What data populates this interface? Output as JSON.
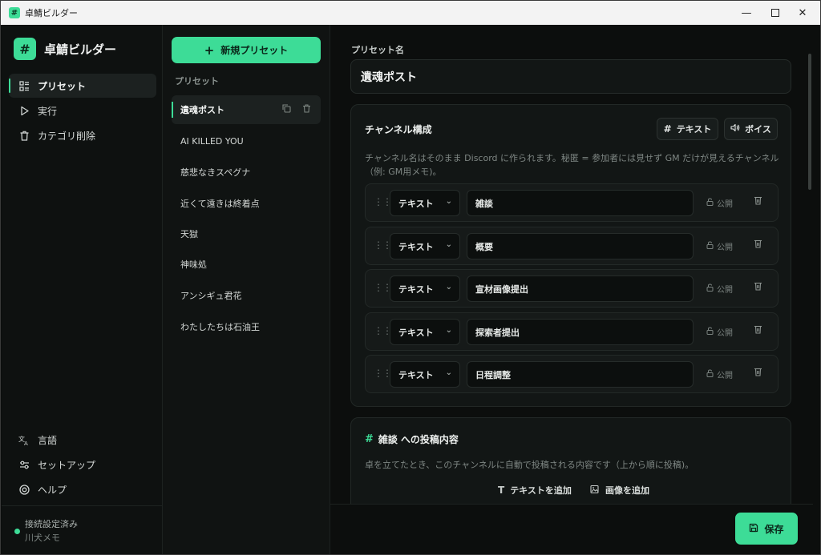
{
  "window": {
    "title": "卓鯖ビルダー",
    "app_icon": "#"
  },
  "sidebar": {
    "brand": "卓鯖ビルダー",
    "brand_logo": "#",
    "nav": [
      {
        "label": "プリセット",
        "icon": "list-icon",
        "active": true
      },
      {
        "label": "実行",
        "icon": "play-icon"
      },
      {
        "label": "カテゴリ削除",
        "icon": "trash-icon"
      }
    ],
    "bottom_nav": [
      {
        "label": "言語",
        "icon": "translate-icon"
      },
      {
        "label": "セットアップ",
        "icon": "sliders-icon"
      },
      {
        "label": "ヘルプ",
        "icon": "lifebuoy-icon"
      }
    ],
    "status": {
      "text": "接続設定済み",
      "user": "川犬メモ"
    }
  },
  "presets": {
    "new_button": "新規プリセット",
    "heading": "プリセット",
    "items": [
      "遺魂ポスト",
      "AI KILLED YOU",
      "慈悲なきスペグナ",
      "近くて遠きは終着点",
      "天獄",
      "神味処",
      "アンシギュ君花",
      "わたしたちは石油王"
    ]
  },
  "main": {
    "name_label": "プリセット名",
    "name_value": "遺魂ポスト",
    "channels": {
      "title": "チャンネル構成",
      "add_text": "テキスト",
      "add_voice": "ボイス",
      "description": "チャンネル名はそのまま Discord に作られます。秘匿 = 参加者には見せず GM だけが見えるチャンネル（例: GM用メモ)。",
      "rows": [
        {
          "type": "テキスト",
          "name": "雑談",
          "visibility": "公開"
        },
        {
          "type": "テキスト",
          "name": "概要",
          "visibility": "公開"
        },
        {
          "type": "テキスト",
          "name": "宣材画像提出",
          "visibility": "公開"
        },
        {
          "type": "テキスト",
          "name": "探索者提出",
          "visibility": "公開"
        },
        {
          "type": "テキスト",
          "name": "日程調整",
          "visibility": "公開"
        }
      ]
    },
    "posts": {
      "channel": "雑談",
      "title_suffix": "への投稿内容",
      "description": "卓を立てたとき、このチャンネルに自動で投稿される内容です（上から順に投稿)。",
      "add_text": "テキストを追加",
      "add_image": "画像を追加"
    }
  },
  "footer": {
    "save": "保存"
  },
  "colors": {
    "accent": "#3ddc97",
    "background": "#0c0e0d",
    "panel": "#121615"
  }
}
